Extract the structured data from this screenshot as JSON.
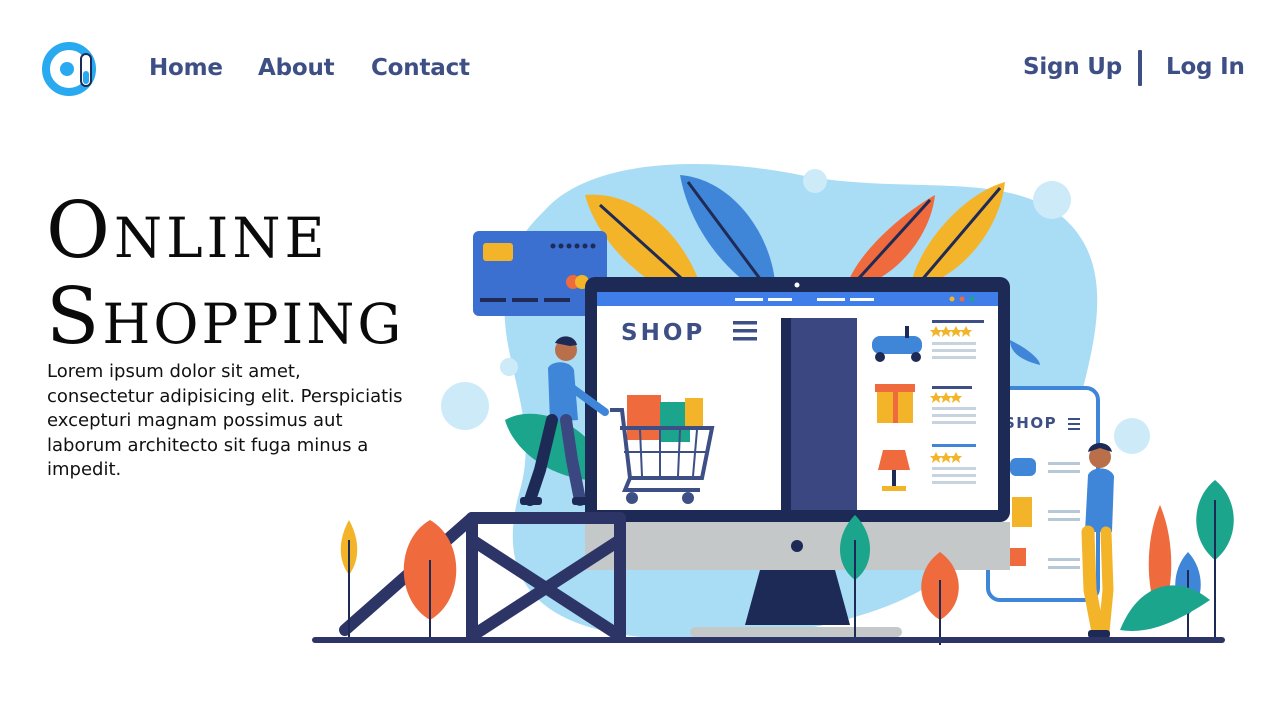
{
  "nav": {
    "home": "Home",
    "about": "About",
    "contact": "Contact",
    "sign_up": "Sign Up",
    "log_in": "Log In"
  },
  "hero": {
    "title_line1": "Online",
    "title_line2": "Shopping",
    "body": "Lorem ipsum dolor sit amet, consectetur adipisicing elit. Perspiciatis excepturi magnam possimus aut laborum architecto sit fuga minus a impedit."
  },
  "illustration": {
    "desktop_shop_label": "SHOP",
    "phone_shop_label": "SHOP"
  },
  "colors": {
    "nav_text": "#3d4f85",
    "logo_blue": "#29a9f0",
    "title_text": "#0a0a0a",
    "blob": "#a9dcf5",
    "screen_bar": "#3f7de8",
    "base_dark": "#2c3566"
  }
}
